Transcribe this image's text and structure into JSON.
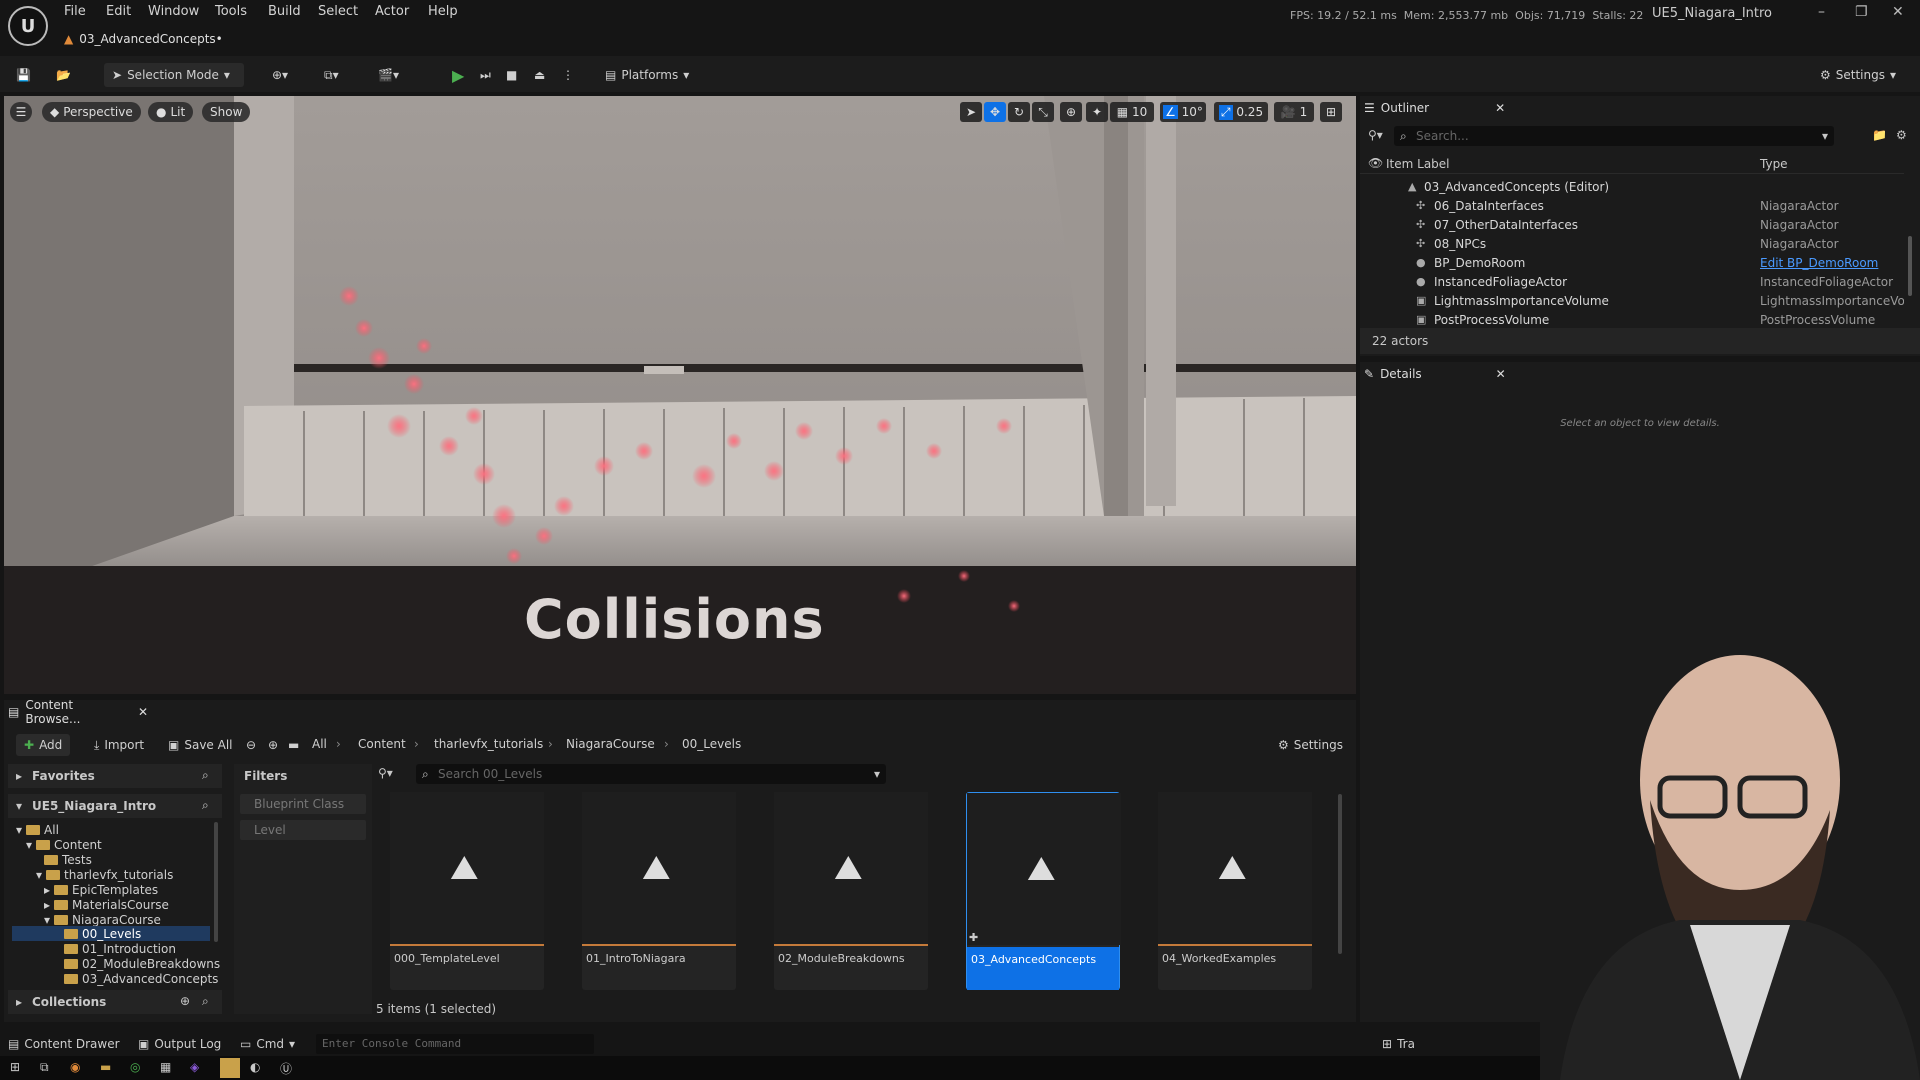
{
  "menubar": {
    "items": [
      "File",
      "Edit",
      "Window",
      "Tools",
      "Build",
      "Select",
      "Actor",
      "Help"
    ],
    "stats": {
      "fps_label": "FPS:",
      "fps": "19.2",
      "ms": "/ 52.1 ms",
      "mem_label": "Mem:",
      "mem": "2,553.77 mb",
      "objs_label": "Objs:",
      "objs": "71,719",
      "stalls_label": "Stalls:",
      "stalls": "22"
    },
    "project_name": "UE5_Niagara_Intro"
  },
  "level_tab": {
    "title": "03_AdvancedConcepts•"
  },
  "toolbar": {
    "selection_mode": "Selection Mode",
    "platforms": "Platforms",
    "settings": "Settings"
  },
  "viewport": {
    "perspective": "Perspective",
    "lit": "Lit",
    "show": "Show",
    "grid_snap": "10",
    "rot_snap": "10°",
    "scale_snap": "0.25",
    "camera_speed": "1",
    "scene_text": "Collisions"
  },
  "outliner": {
    "title": "Outliner",
    "search_placeholder": "Search...",
    "col_label": "Item Label",
    "col_type": "Type",
    "root": "03_AdvancedConcepts (Editor)",
    "rows": [
      {
        "label": "06_DataInterfaces",
        "type": "NiagaraActor"
      },
      {
        "label": "07_OtherDataInterfaces",
        "type": "NiagaraActor"
      },
      {
        "label": "08_NPCs",
        "type": "NiagaraActor"
      },
      {
        "label": "BP_DemoRoom",
        "type": "Edit BP_DemoRoom"
      },
      {
        "label": "InstancedFoliageActor",
        "type": "InstancedFoliageActor"
      },
      {
        "label": "LightmassImportanceVolume",
        "type": "LightmassImportanceVol"
      },
      {
        "label": "PostProcessVolume",
        "type": "PostProcessVolume"
      }
    ],
    "actor_count": "22 actors"
  },
  "details": {
    "title": "Details",
    "empty_msg": "Select an object to view details."
  },
  "content_browser": {
    "tab_title": "Content Browse...",
    "add": "Add",
    "import": "Import",
    "save_all": "Save All",
    "breadcrumbs": [
      "All",
      "Content",
      "tharlevfx_tutorials",
      "NiagaraCourse",
      "00_Levels"
    ],
    "settings": "Settings",
    "favorites": "Favorites",
    "project": "UE5_Niagara_Intro",
    "tree": [
      "All",
      "Content",
      "Tests",
      "tharlevfx_tutorials",
      "EpicTemplates",
      "MaterialsCourse",
      "NiagaraCourse",
      "00_Levels",
      "01_Introduction",
      "02_ModuleBreakdowns",
      "03_AdvancedConcepts"
    ],
    "collections": "Collections",
    "filters": "Filters",
    "filter_chips": [
      "Blueprint Class",
      "Level"
    ],
    "search_placeholder": "Search 00_Levels",
    "assets": [
      "000_TemplateLevel",
      "01_IntroToNiagara",
      "02_ModuleBreakdowns",
      "03_AdvancedConcepts",
      "04_WorkedExamples"
    ],
    "selected_asset": "03_AdvancedConcepts",
    "status": "5 items (1 selected)"
  },
  "bottombar": {
    "content_drawer": "Content Drawer",
    "output_log": "Output Log",
    "cmd": "Cmd",
    "console_placeholder": "Enter Console Command",
    "trace": "Tra"
  },
  "colors": {
    "accent": "#0e71e6",
    "play": "#4caf50",
    "particle": "#ff5a6a",
    "folder": "#c9a14a"
  }
}
